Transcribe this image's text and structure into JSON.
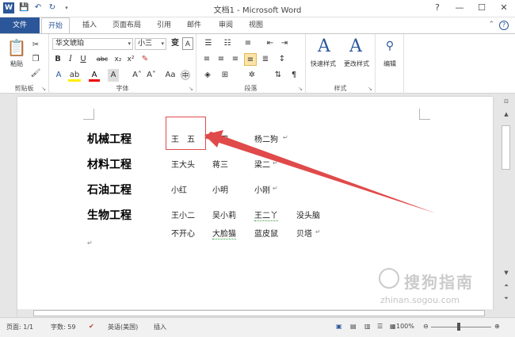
{
  "titlebar": {
    "title": "文档1 - Microsoft Word",
    "app_icon": "W",
    "qat": [
      "save-icon",
      "undo-icon",
      "redo-icon",
      "customize-icon"
    ],
    "controls": [
      "?",
      "—",
      "☐",
      "✕"
    ]
  },
  "tabs": [
    {
      "label": "文件",
      "active": false
    },
    {
      "label": "开始",
      "active": true
    },
    {
      "label": "插入",
      "active": false
    },
    {
      "label": "页面布局",
      "active": false
    },
    {
      "label": "引用",
      "active": false
    },
    {
      "label": "邮件",
      "active": false
    },
    {
      "label": "审阅",
      "active": false
    },
    {
      "label": "视图",
      "active": false
    }
  ],
  "ribbon": {
    "clipboard": {
      "label": "剪贴板",
      "paste": "粘贴"
    },
    "font": {
      "label": "字体",
      "font_name": "华文琥珀",
      "font_size": "小三"
    },
    "paragraph": {
      "label": "段落"
    },
    "styles": {
      "label": "样式",
      "quick": "快速样式",
      "change": "更改样式"
    },
    "editing": {
      "label": "编辑"
    }
  },
  "document": {
    "rows": [
      {
        "heading": "机械工程",
        "cells": [
          "王　五",
          "赵四",
          "杨二狗"
        ]
      },
      {
        "heading": "材料工程",
        "cells": [
          "王大头",
          "蒋三",
          "梁二"
        ]
      },
      {
        "heading": "石油工程",
        "cells": [
          "小红",
          "小明",
          "小刚"
        ]
      },
      {
        "heading": "生物工程",
        "cells": [
          "王小二",
          "吴小莉",
          "王二丫",
          "没头脑"
        ]
      },
      {
        "heading": "",
        "cells": [
          "不开心",
          "大脸猫",
          "蓝皮鼠",
          "贝塔"
        ]
      }
    ],
    "paragraph_mark": "↵"
  },
  "statusbar": {
    "page": "页面: 1/1",
    "words": "字数: 59",
    "language": "英语(美国)",
    "mode": "插入",
    "zoom": "100%"
  },
  "watermark": {
    "brand": "搜狗指南",
    "url": "zhinan.sogou.com"
  },
  "colors": {
    "accent": "#2b579a",
    "annotation": "#e04a4a"
  }
}
